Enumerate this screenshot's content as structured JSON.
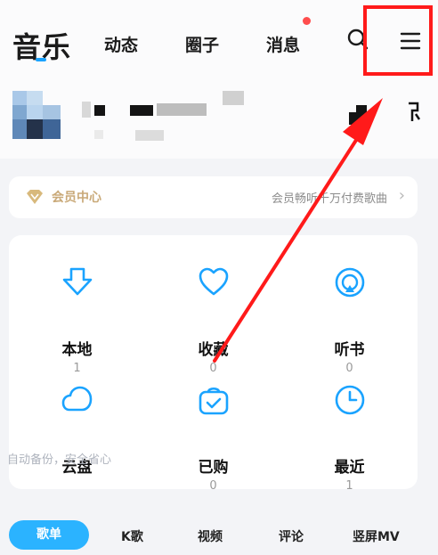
{
  "topbar": {
    "music_tab": "音乐",
    "tabs": [
      "动态",
      "圈子",
      "消息"
    ],
    "icons": [
      "search-icon",
      "menu-icon"
    ]
  },
  "vip": {
    "label": "会员中心",
    "promo": "会员畅听千万付费歌曲",
    "chevron": "›"
  },
  "grid": {
    "items": [
      {
        "label": "本地",
        "count": "1",
        "icon": "download-icon"
      },
      {
        "label": "收藏",
        "count": "0",
        "icon": "heart-icon"
      },
      {
        "label": "听书",
        "count": "0",
        "icon": "audiobook-icon"
      },
      {
        "label": "云盘",
        "count": "",
        "icon": "cloud-icon"
      },
      {
        "label": "已购",
        "count": "0",
        "icon": "purchased-bag-icon"
      },
      {
        "label": "最近",
        "count": "1",
        "icon": "clock-icon"
      }
    ],
    "cloud_note": "自动备份，安全省心"
  },
  "bottom_tabs": {
    "active": "歌单",
    "others": [
      "K歌",
      "视频",
      "评论",
      "竖屏MV"
    ]
  },
  "colors": {
    "accent": "#1aa3ff",
    "highlight": "#ff1a1a",
    "vip_gold": "#c9a978"
  }
}
